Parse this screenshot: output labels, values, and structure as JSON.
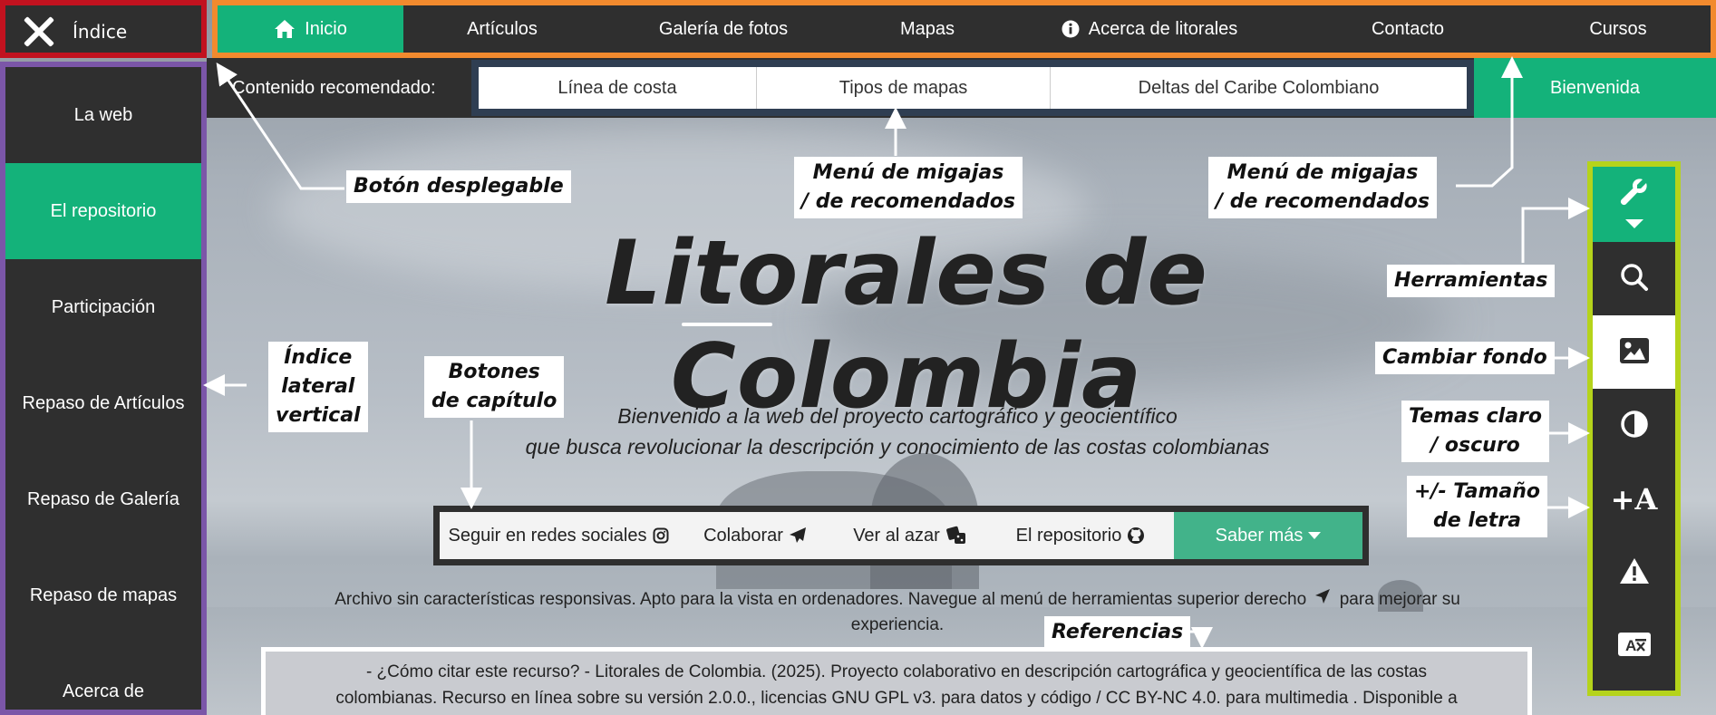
{
  "index_button": {
    "label": "Índice"
  },
  "topnav": {
    "items": [
      {
        "label": "Inicio",
        "icon": "home-icon",
        "active": true
      },
      {
        "label": "Artículos"
      },
      {
        "label": "Galería de fotos"
      },
      {
        "label": "Mapas"
      },
      {
        "label": "Acerca de litorales",
        "icon": "info-icon"
      },
      {
        "label": "Contacto"
      },
      {
        "label": "Cursos"
      }
    ]
  },
  "recommended": {
    "label": "Contenido recomendado:",
    "items": [
      "Línea de costa",
      "Tipos de mapas",
      "Deltas del Caribe Colombiano"
    ],
    "welcome": "Bienvenida"
  },
  "sidebar": {
    "items": [
      {
        "label": "La web"
      },
      {
        "label": "El repositorio",
        "active": true
      },
      {
        "label": "Participación"
      },
      {
        "label": "Repaso de Artículos"
      },
      {
        "label": "Repaso de Galería"
      },
      {
        "label": "Repaso de mapas"
      },
      {
        "label": "Acerca de"
      }
    ]
  },
  "hero": {
    "title": "Litorales de Colombia",
    "subtitle_line1": "Bienvenido a la web del proyecto cartográfico y geocientífico",
    "subtitle_line2": "que busca revolucionar la descripción y conocimiento de las costas colombianas"
  },
  "chapters": {
    "items": [
      {
        "label": "Seguir en redes sociales",
        "icon": "instagram-icon"
      },
      {
        "label": "Colaborar",
        "icon": "paper-plane-icon"
      },
      {
        "label": "Ver al azar",
        "icon": "dice-icon"
      },
      {
        "label": "El repositorio",
        "icon": "github-icon"
      },
      {
        "label": "Saber más",
        "icon": "caret-down-icon"
      }
    ]
  },
  "note": {
    "line1": "Archivo sin características responsivas. Apto para la vista en ordenadores. Navegue al menú de herramientas superior derecho",
    "line1_end": "para mejorar su",
    "line2": "experiencia."
  },
  "citation": {
    "line1": "- ¿Cómo citar este recurso? - Litorales de Colombia. (2025). Proyecto colaborativo en descripción cartográfica y geocientífica de las costas",
    "line2": "colombianas. Recurso en línea sobre su versión 2.0.0., licencias GNU GPL v3. para datos y código / CC BY-NC 4.0. para multimedia . Disponible a"
  },
  "tools": {
    "items": [
      "wrench-icon",
      "search-icon",
      "image-icon",
      "contrast-icon",
      "font-size-icon",
      "warning-icon",
      "translate-icon"
    ]
  },
  "annotations": {
    "dropdown_button": "Botón desplegable",
    "breadcrumb_1a": "Menú de migajas",
    "breadcrumb_1b": "/ de recomendados",
    "breadcrumb_2a": "Menú de migajas",
    "breadcrumb_2b": "/ de recomendados",
    "tools": "Herramientas",
    "vertical_index_a": "Índice",
    "vertical_index_b": "lateral",
    "vertical_index_c": "vertical",
    "chapter_buttons_a": "Botones",
    "chapter_buttons_b": "de capítulo",
    "change_background": "Cambiar fondo",
    "themes_a": "Temas claro",
    "themes_b": "/ oscuro",
    "font_size_a": "+/- Tamaño",
    "font_size_b": "de letra",
    "references": "Referencias"
  },
  "colors": {
    "accent_green": "#14b27a",
    "dark_bg": "#2f2f2f",
    "frame_red": "#c1121f",
    "frame_orange": "#f28a2e",
    "frame_purple": "#7b56a8",
    "frame_lime": "#b5d31b",
    "frame_navy": "#2f3e52"
  }
}
